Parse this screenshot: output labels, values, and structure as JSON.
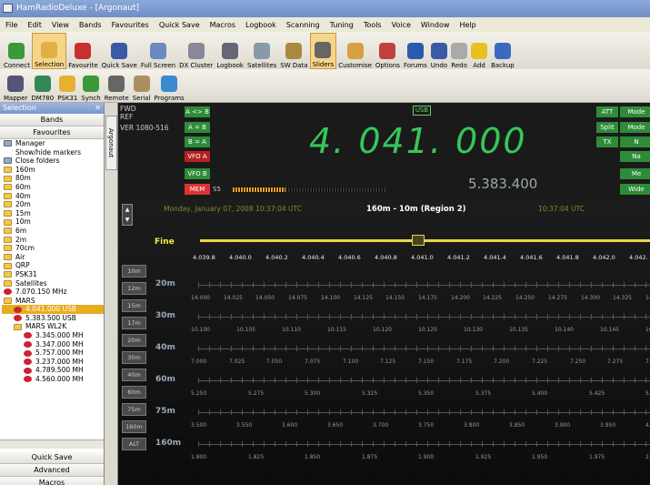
{
  "window": {
    "title": "HamRadioDeluxe - [Argonaut]"
  },
  "menu": [
    "File",
    "Edit",
    "View",
    "Bands",
    "Favourites",
    "Quick Save",
    "Macros",
    "Logbook",
    "Scanning",
    "Tuning",
    "Tools",
    "Voice",
    "Window",
    "Help"
  ],
  "toolbar1": [
    {
      "label": "Connect",
      "icon": "connect-icon",
      "color": "#3a9a3a"
    },
    {
      "label": "Selection",
      "icon": "folder-icon",
      "color": "#e0b040",
      "selected": true
    },
    {
      "label": "Favourite",
      "icon": "heart-icon",
      "color": "#c83030"
    },
    {
      "label": "Quick Save",
      "icon": "save-icon",
      "color": "#3a5aa8"
    },
    {
      "label": "Full Screen",
      "icon": "screen-icon",
      "color": "#6a8ac0"
    },
    {
      "label": "DX Cluster",
      "icon": "cluster-icon",
      "color": "#889"
    },
    {
      "label": "Logbook",
      "icon": "logbook-icon",
      "color": "#667"
    },
    {
      "label": "Satellites",
      "icon": "satellite-icon",
      "color": "#889aaa"
    },
    {
      "label": "SW Data",
      "icon": "swdata-icon",
      "color": "#aa8840"
    },
    {
      "label": "Sliders",
      "icon": "sliders-icon",
      "color": "#666",
      "selected": true
    },
    {
      "label": "Customise",
      "icon": "customise-icon",
      "color": "#d8a040"
    },
    {
      "label": "Options",
      "icon": "options-icon",
      "color": "#c04040"
    },
    {
      "label": "Forums",
      "icon": "home-icon",
      "color": "#2a5ab0"
    },
    {
      "label": "Undo",
      "icon": "undo-icon",
      "color": "#3a5aa8"
    },
    {
      "label": "Redo",
      "icon": "redo-icon",
      "color": "#aaa"
    },
    {
      "label": "Add",
      "icon": "star-icon",
      "color": "#e8c020"
    },
    {
      "label": "Backup",
      "icon": "backup-icon",
      "color": "#3a6ac0"
    }
  ],
  "toolbar2": [
    {
      "label": "Mapper",
      "icon": "mapper-icon",
      "color": "#557"
    },
    {
      "label": "DM780",
      "icon": "dm780-icon",
      "color": "#385"
    },
    {
      "label": "PSK31",
      "icon": "psk31-icon",
      "color": "#e8b030"
    },
    {
      "label": "Synch",
      "icon": "synch-icon",
      "color": "#3a9a3a"
    },
    {
      "label": "Remote",
      "icon": "remote-icon",
      "color": "#666"
    },
    {
      "label": "Serial",
      "icon": "serial-icon",
      "color": "#aa9060"
    },
    {
      "label": "Programs",
      "icon": "programs-icon",
      "color": "#3a8ad0"
    }
  ],
  "sidebar": {
    "title": "Selection",
    "bands_label": "Bands",
    "favourites_label": "Favourites",
    "items": [
      {
        "label": "Manager",
        "type": "doc"
      },
      {
        "label": "Show/hide markers",
        "type": "none"
      },
      {
        "label": "Close folders",
        "type": "doc"
      },
      {
        "label": "160m",
        "type": "fold"
      },
      {
        "label": "80m",
        "type": "fold"
      },
      {
        "label": "60m",
        "type": "fold"
      },
      {
        "label": "40m",
        "type": "fold"
      },
      {
        "label": "20m",
        "type": "fold"
      },
      {
        "label": "15m",
        "type": "fold"
      },
      {
        "label": "10m",
        "type": "fold"
      },
      {
        "label": "6m",
        "type": "fold"
      },
      {
        "label": "2m",
        "type": "fold"
      },
      {
        "label": "70cm",
        "type": "fold"
      },
      {
        "label": "Air",
        "type": "fold"
      },
      {
        "label": "QRP",
        "type": "fold"
      },
      {
        "label": "PSK31",
        "type": "fold"
      },
      {
        "label": "Satellites",
        "type": "fold"
      },
      {
        "label": "7.070.150 MHz",
        "type": "heart"
      },
      {
        "label": "MARS",
        "type": "fold"
      },
      {
        "label": "4.041.000 USB",
        "type": "heart",
        "indent": 1,
        "highlight": true
      },
      {
        "label": "5.383.500 USB",
        "type": "heart",
        "indent": 1
      },
      {
        "label": "MARS WL2K",
        "type": "fold",
        "indent": 1
      },
      {
        "label": "3.345.000 MH",
        "type": "heart",
        "indent": 2
      },
      {
        "label": "3.347.000 MH",
        "type": "heart",
        "indent": 2
      },
      {
        "label": "5.757.000 MH",
        "type": "heart",
        "indent": 2
      },
      {
        "label": "3.237.000 MH",
        "type": "heart",
        "indent": 2
      },
      {
        "label": "4.789.500 MH",
        "type": "heart",
        "indent": 2
      },
      {
        "label": "4.560.000 MH",
        "type": "heart",
        "indent": 2
      }
    ],
    "bottom": [
      "Quick Save",
      "Advanced",
      "Macros"
    ]
  },
  "dock_tab": "Argonaut",
  "radio": {
    "fwd": "FWD",
    "ref": "REF",
    "ver": "VER 1080-516",
    "vfo_buttons": [
      {
        "label": "A <> B",
        "style": "g"
      },
      {
        "label": "A = B",
        "style": "g"
      },
      {
        "label": "B = A",
        "style": "g"
      },
      {
        "label": "VFO A",
        "style": "r"
      },
      {
        "label": "VFO B",
        "style": "g"
      },
      {
        "label": "MEM",
        "style": "rr"
      }
    ],
    "mode_badge": "USB",
    "main_freq": "4. 041. 000",
    "sub_freq": "5.383.400",
    "s_meter_label": "S5",
    "right_buttons": [
      "ATT",
      "Split",
      "TX",
      "Mode",
      "Mode",
      "N",
      "Na",
      "Me",
      "Wide"
    ]
  },
  "tuner": {
    "date": "Monday, January 07, 2008 10:37:04 UTC",
    "region": "160m - 10m (Region 2)",
    "utc_time": "10:37:04 UTC",
    "fine_label": "Fine",
    "fine_ticks": [
      "4.039.8",
      "4.040.0",
      "4.040.2",
      "4.040.4",
      "4.040.6",
      "4.040.8",
      "4.041.0",
      "4.041.2",
      "4.041.4",
      "4.041.6",
      "4.041.8",
      "4.042.0",
      "4.042."
    ],
    "band_buttons": [
      "10m",
      "12m",
      "15m",
      "17m",
      "20m",
      "30m",
      "40m",
      "60m",
      "75m",
      "160m",
      "ALT"
    ],
    "bands": [
      {
        "label": "20m",
        "ticks": [
          "14.000",
          "14.025",
          "14.050",
          "14.075",
          "14.100",
          "14.125",
          "14.150",
          "14.175",
          "14.200",
          "14.225",
          "14.250",
          "14.275",
          "14.300",
          "14.325",
          "14."
        ]
      },
      {
        "label": "30m",
        "ticks": [
          "10.100",
          "10.105",
          "10.110",
          "10.115",
          "10.120",
          "10.125",
          "10.130",
          "10.135",
          "10.140",
          "10.145",
          "10."
        ]
      },
      {
        "label": "40m",
        "ticks": [
          "7.000",
          "7.025",
          "7.050",
          "7.075",
          "7.100",
          "7.125",
          "7.150",
          "7.175",
          "7.200",
          "7.225",
          "7.250",
          "7.275",
          "7."
        ]
      },
      {
        "label": "60m",
        "ticks": [
          "5.250",
          "5.275",
          "5.300",
          "5.325",
          "5.350",
          "5.375",
          "5.400",
          "5.425",
          "5.4"
        ]
      },
      {
        "label": "75m",
        "ticks": [
          "3.500",
          "3.550",
          "3.600",
          "3.650",
          "3.700",
          "3.750",
          "3.800",
          "3.850",
          "3.900",
          "3.950",
          "4."
        ]
      },
      {
        "label": "160m",
        "ticks": [
          "1.800",
          "1.825",
          "1.850",
          "1.875",
          "1.900",
          "1.925",
          "1.950",
          "1.975",
          "2."
        ]
      }
    ]
  }
}
